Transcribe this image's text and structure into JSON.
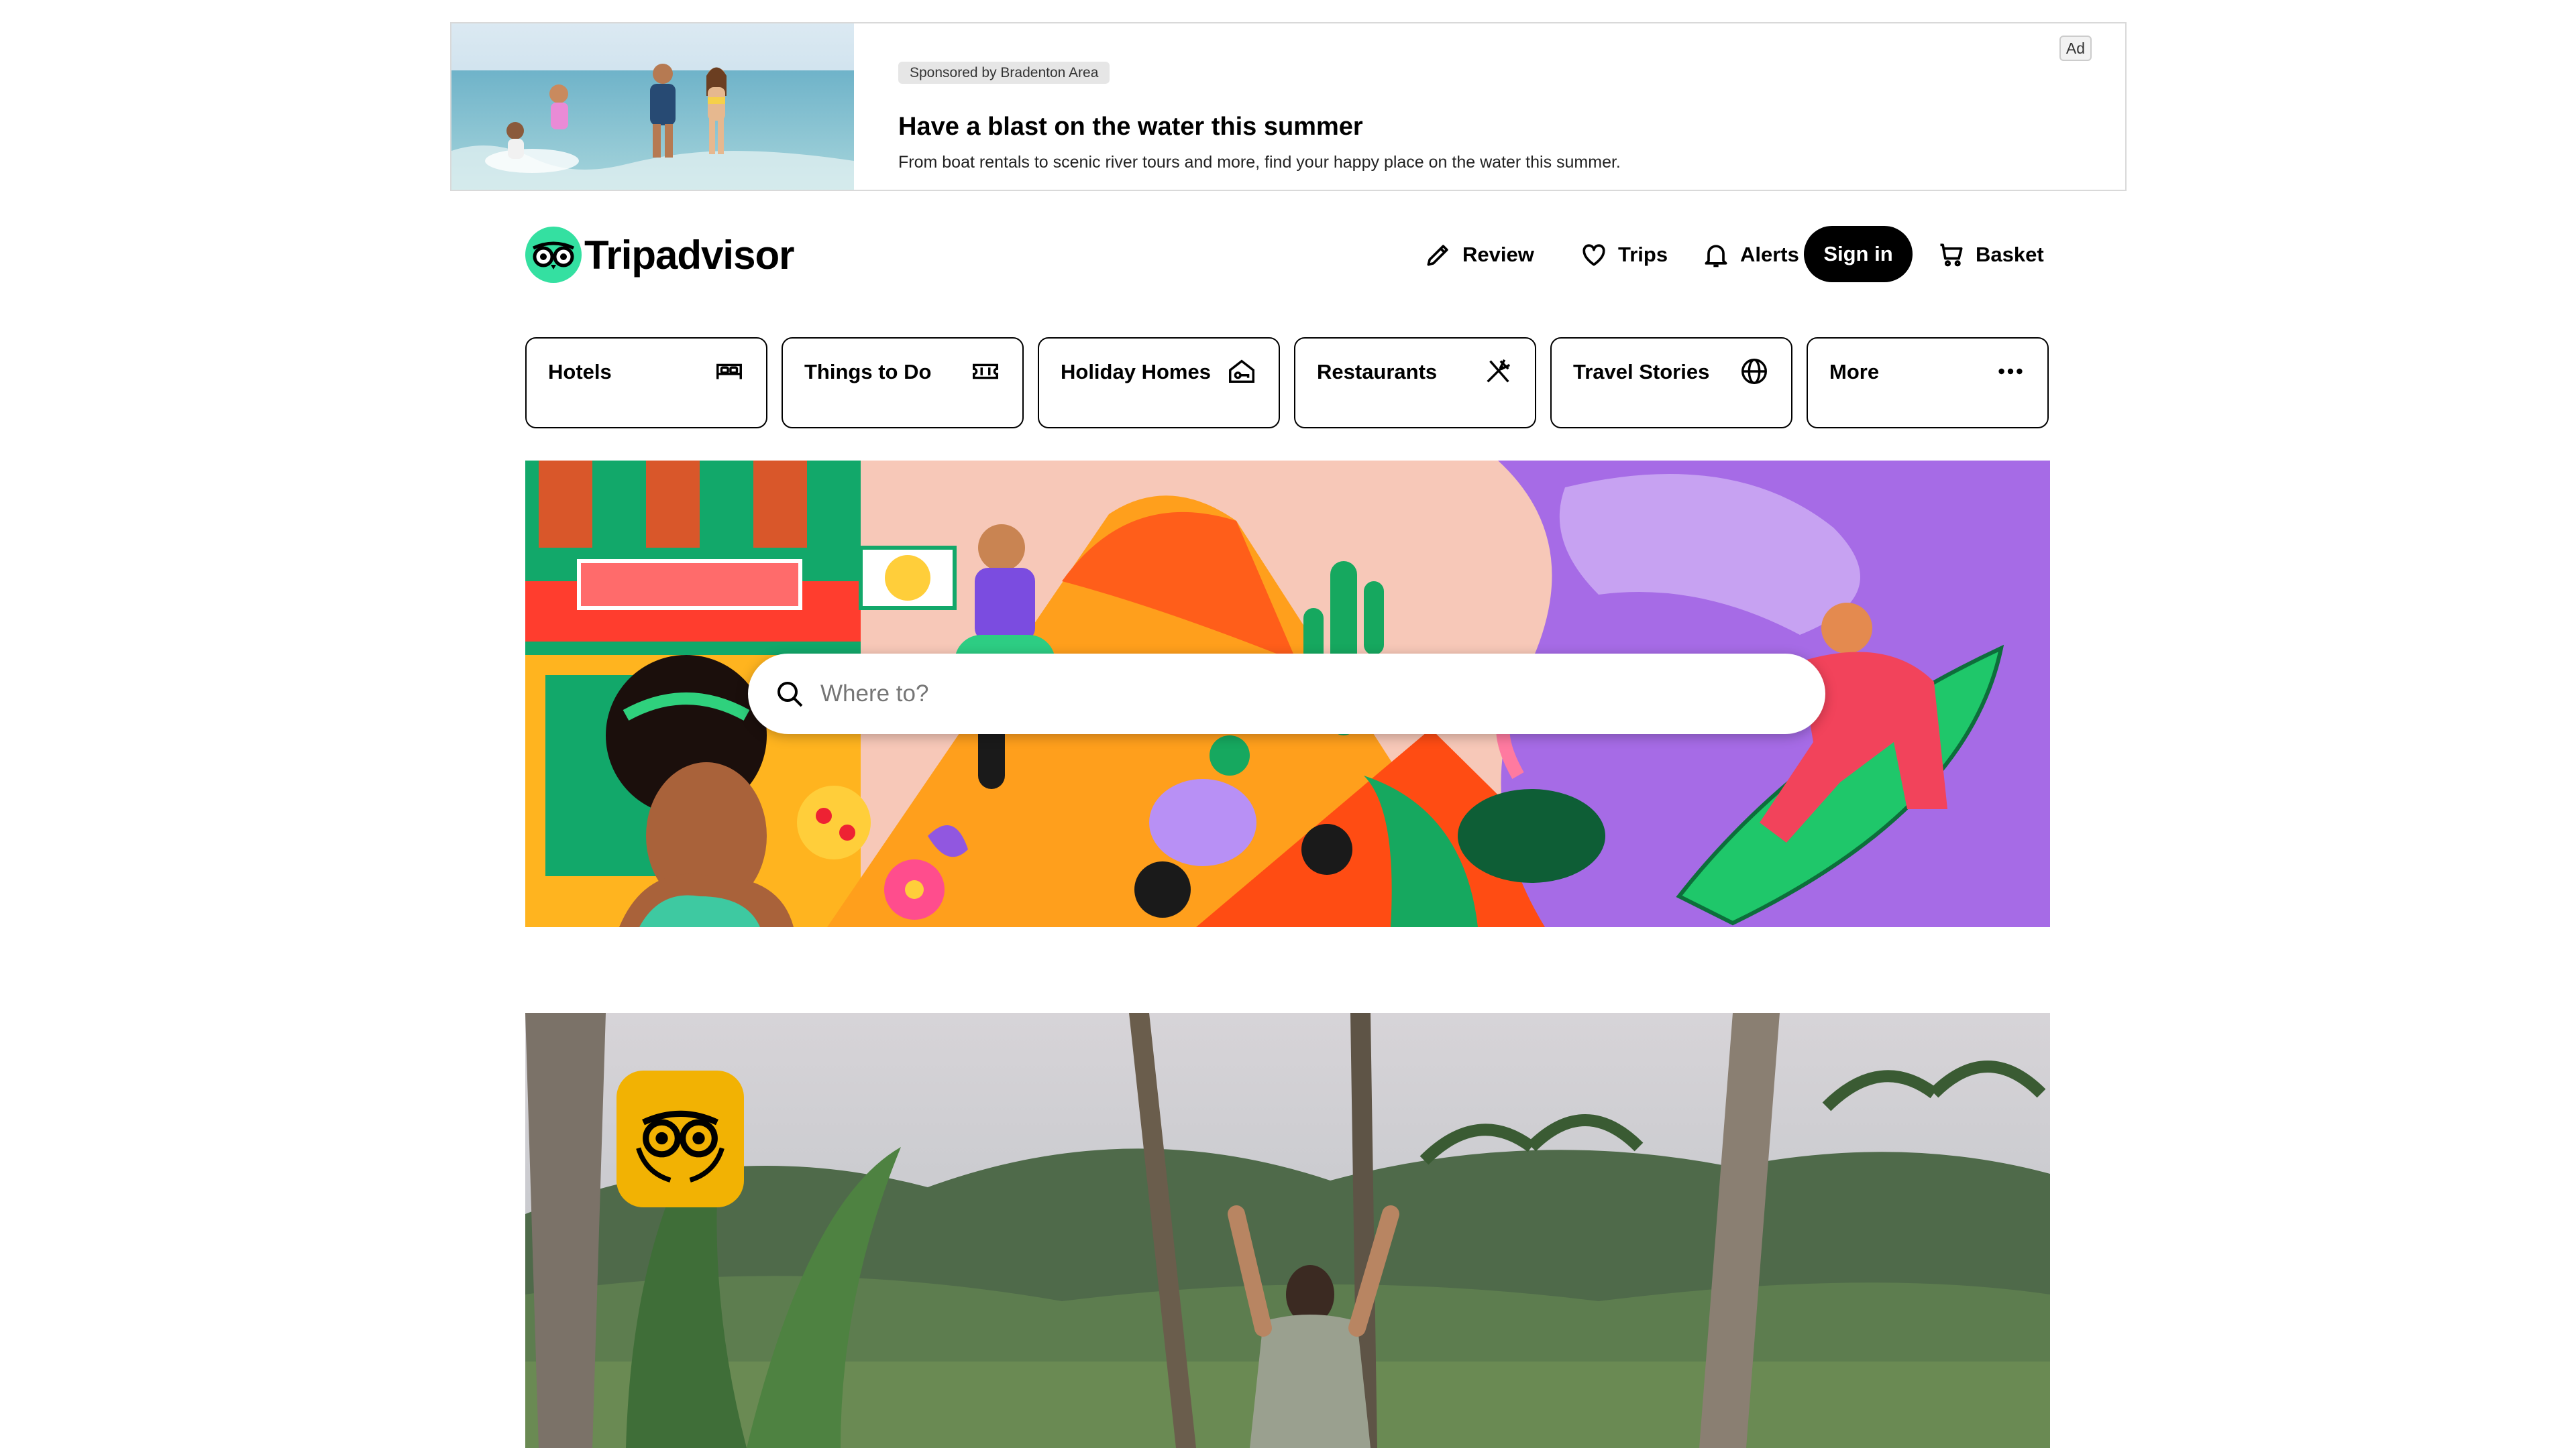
{
  "ad": {
    "sponsor": "Sponsored by Bradenton Area",
    "title": "Have a blast on the water this summer",
    "description": "From boat rentals to scenic river tours and more, find your happy place on the water this summer.",
    "badge": "Ad"
  },
  "brand": {
    "name": "Tripadvisor",
    "accent": "#34e0a1"
  },
  "header": {
    "review": "Review",
    "trips": "Trips",
    "alerts": "Alerts",
    "sign_in": "Sign in",
    "basket": "Basket"
  },
  "categories": [
    {
      "label": "Hotels",
      "icon": "bed-icon"
    },
    {
      "label": "Things to Do",
      "icon": "ticket-icon"
    },
    {
      "label": "Holiday Homes",
      "icon": "house-key-icon"
    },
    {
      "label": "Restaurants",
      "icon": "fork-knife-icon"
    },
    {
      "label": "Travel Stories",
      "icon": "globe-icon"
    },
    {
      "label": "More",
      "icon": "more-dots-icon"
    }
  ],
  "search": {
    "placeholder": "Where to?"
  }
}
